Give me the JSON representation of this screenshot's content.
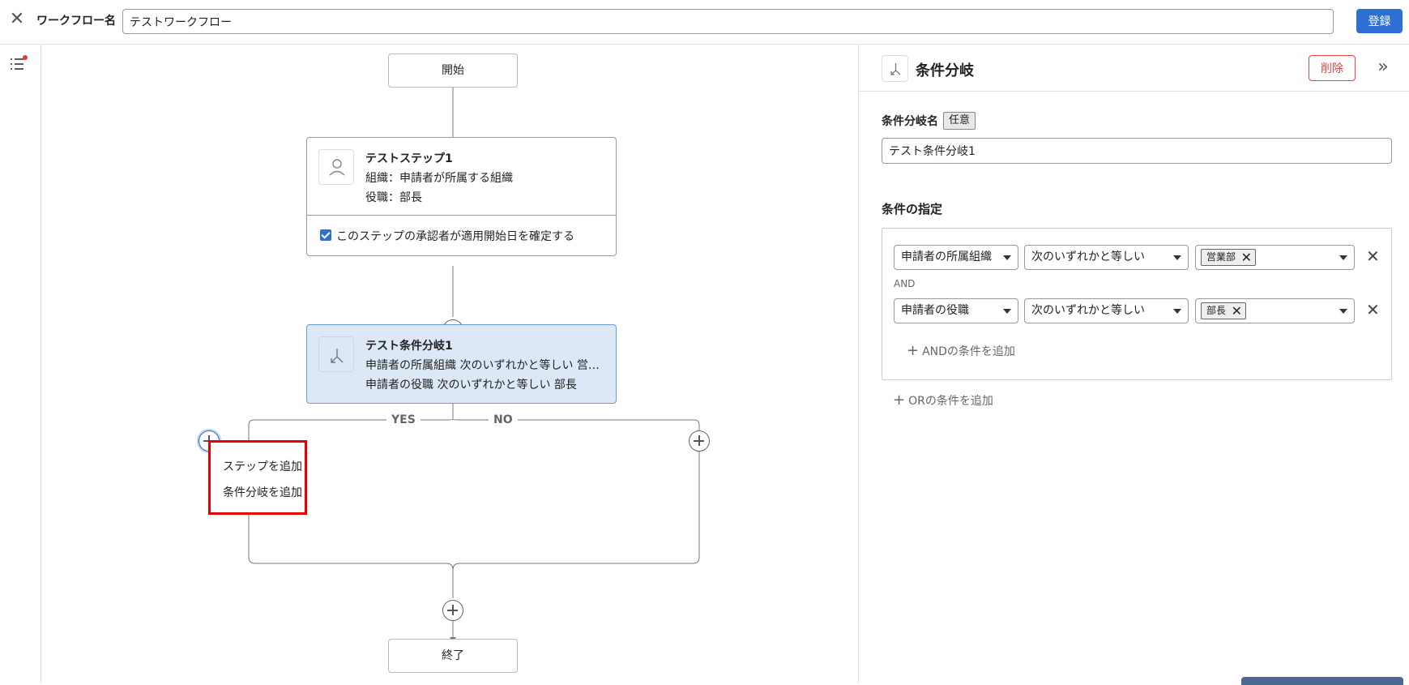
{
  "header": {
    "close_icon": "close-icon",
    "workflow_name_label": "ワークフロー名",
    "workflow_name_value": "テストワークフロー",
    "register_label": "登録"
  },
  "left_rail": {
    "icon": "list-icon",
    "has_notification": true
  },
  "flow": {
    "start_label": "開始",
    "end_label": "終了",
    "step1": {
      "title": "テストステップ1",
      "line1": "組織：申請者が所属する組織",
      "line2": "役職：部長",
      "checkbox_label": "このステップの承認者が適用開始日を確定する",
      "checkbox_checked": true,
      "icon": "person-icon"
    },
    "branch1": {
      "title": "テスト条件分岐1",
      "line1": "申請者の所属組織  次のいずれかと等しい  営…",
      "line2": "申請者の役職  次のいずれかと等しい  部長",
      "icon": "branch-icon"
    },
    "yes_label": "YES",
    "no_label": "NO",
    "add_menu": {
      "add_step": "ステップを追加",
      "add_branch": "条件分岐を追加"
    }
  },
  "panel": {
    "title": "条件分岐",
    "delete_label": "削除",
    "collapse_icon": "double-chevron-right-icon",
    "name_label": "条件分岐名",
    "optional_badge": "任意",
    "name_value": "テスト条件分岐1",
    "conditions_title": "条件の指定",
    "conditions": [
      {
        "field": "申請者の所属組織",
        "operator": "次のいずれかと等しい",
        "value": "営業部"
      },
      {
        "field": "申請者の役職",
        "operator": "次のいずれかと等しい",
        "value": "部長"
      }
    ],
    "and_label": "AND",
    "add_and_label": "ANDの条件を追加",
    "add_or_label": "ORの条件を追加"
  },
  "colors": {
    "accent": "#2f6fd1",
    "danger": "#e04747",
    "branch_bg": "#dde8f6",
    "highlight": "#e60000"
  }
}
